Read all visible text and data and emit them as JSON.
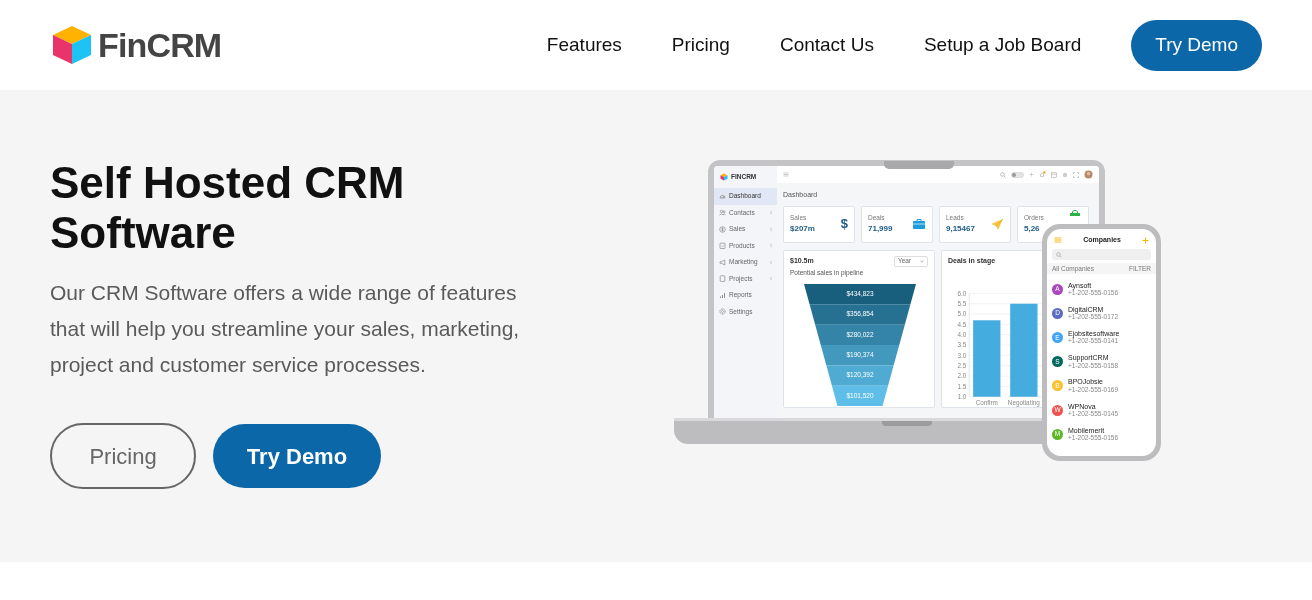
{
  "header": {
    "logo": "FinCRM",
    "nav": [
      {
        "label": "Features"
      },
      {
        "label": "Pricing"
      },
      {
        "label": "Contact Us"
      },
      {
        "label": "Setup a Job Board"
      }
    ],
    "cta": "Try Demo"
  },
  "hero": {
    "title": "Self Hosted CRM Software",
    "description": "Our CRM Software offers a wide range of features that will help you streamline your sales, marketing, project and customer service processes.",
    "buttons": [
      {
        "label": "Pricing",
        "kind": "outline"
      },
      {
        "label": "Try Demo",
        "kind": "filled"
      }
    ]
  },
  "dashboard": {
    "brand": "FINCRM",
    "page_title": "Dashboard",
    "sidebar": [
      {
        "label": "Dashboard",
        "selected": true,
        "submenu": false
      },
      {
        "label": "Contacts",
        "selected": false,
        "submenu": true
      },
      {
        "label": "Sales",
        "selected": false,
        "submenu": true
      },
      {
        "label": "Products",
        "selected": false,
        "submenu": true
      },
      {
        "label": "Marketing",
        "selected": false,
        "submenu": true
      },
      {
        "label": "Projects",
        "selected": false,
        "submenu": true
      },
      {
        "label": "Reports",
        "selected": false,
        "submenu": false
      },
      {
        "label": "Settings",
        "selected": false,
        "submenu": false
      }
    ],
    "stats": [
      {
        "label": "Sales",
        "value": "$207m",
        "kind": "symbol",
        "symbol": "$"
      },
      {
        "label": "Deals",
        "value": "71,999",
        "kind": "briefcase"
      },
      {
        "label": "Leads",
        "value": "9,15467",
        "kind": "plane"
      },
      {
        "label": "Orders",
        "value": "5,26",
        "kind": "bag"
      }
    ],
    "funnel": {
      "total": "$10.5m",
      "caption": "Potential sales in pipeline",
      "period": "Year",
      "segments": [
        "$434,823",
        "$356,854",
        "$280,022",
        "$190,374",
        "$120,392",
        "$101,520"
      ]
    },
    "deals_chart": {
      "chart_data": {
        "type": "bar",
        "title": "Deals in stage",
        "grid": true,
        "categories": [
          "Confirm",
          "Negotiating"
        ],
        "values": [
          4.7,
          5.5
        ],
        "ylim": [
          1,
          6
        ],
        "yticks": [
          {
            "value": 6,
            "label": "6.0"
          },
          {
            "value": 5.5,
            "label": "5.5"
          },
          {
            "value": 5,
            "label": "5.0"
          },
          {
            "value": 4.5,
            "label": "4.5"
          },
          {
            "value": 4,
            "label": "4.0"
          },
          {
            "value": 3.5,
            "label": "3.5"
          },
          {
            "value": 3,
            "label": "3.0"
          },
          {
            "value": 2.5,
            "label": "2.5"
          },
          {
            "value": 2,
            "label": "2.0"
          },
          {
            "value": 1.5,
            "label": "1.5"
          },
          {
            "value": 1,
            "label": "1.0"
          }
        ]
      }
    }
  },
  "phone": {
    "title": "Companies",
    "list_label": "All Companies",
    "filter": "FILTER",
    "companies": [
      {
        "initial": "A",
        "name": "Aynsoft",
        "phone": "+1-202-555-0156",
        "color": "#ab47bc"
      },
      {
        "initial": "D",
        "name": "DigitalCRM",
        "phone": "+1-202-555-0172",
        "color": "#5c6bc0"
      },
      {
        "initial": "E",
        "name": "Ejobsitesoftware",
        "phone": "+1-202-555-0141",
        "color": "#42a5f5"
      },
      {
        "initial": "S",
        "name": "SupportCRM",
        "phone": "+1-202-555-0158",
        "color": "#00695c"
      },
      {
        "initial": "B",
        "name": "BPOJobsie",
        "phone": "+1-202-555-0169",
        "color": "#fbc02d"
      },
      {
        "initial": "W",
        "name": "WPNova",
        "phone": "+1-202-555-0145",
        "color": "#ef5350"
      },
      {
        "initial": "M",
        "name": "Mobilemerit",
        "phone": "+1-202-555-0156",
        "color": "#5cb82a"
      }
    ]
  }
}
